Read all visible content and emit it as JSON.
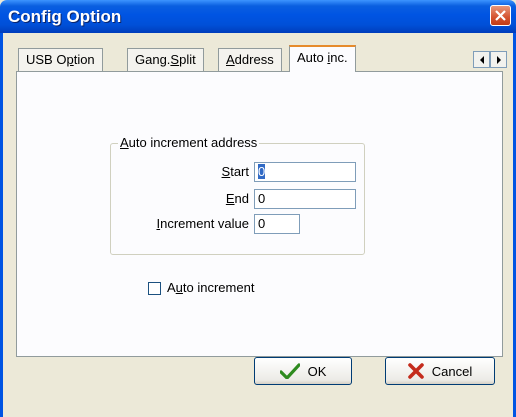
{
  "window": {
    "title": "Config Option"
  },
  "tabs": [
    {
      "label_pre": "USB O",
      "label_key": "p",
      "label_post": "tion"
    },
    {
      "label_pre": "Gang.",
      "label_key": "S",
      "label_post": "plit"
    },
    {
      "label_pre": "",
      "label_key": "A",
      "label_post": "ddress"
    },
    {
      "label_pre": "Auto ",
      "label_key": "i",
      "label_post": "nc.",
      "active": true
    }
  ],
  "group": {
    "legend_key": "A",
    "legend_rest": "uto increment address"
  },
  "fields": {
    "start": {
      "label_key": "S",
      "label_rest": "tart",
      "value": "0"
    },
    "end": {
      "label_key": "E",
      "label_rest": "nd",
      "value": "0"
    },
    "increment": {
      "label_key": "I",
      "label_rest": "ncrement value",
      "value": "0"
    }
  },
  "checkbox": {
    "label_pre": "A",
    "label_key": "u",
    "label_post": "to increment",
    "checked": false
  },
  "buttons": {
    "ok": "OK",
    "cancel": "Cancel"
  },
  "icons": {
    "close": "close-icon",
    "ok": "checkmark-icon",
    "cancel": "cross-icon",
    "left": "arrow-left-icon",
    "right": "arrow-right-icon"
  },
  "colors": {
    "titlebar": "#0054e3",
    "face": "#ece9d8",
    "tab_highlight": "#e68b2c",
    "ok_check": "#2e8b1f",
    "cancel_x": "#c42b1c"
  }
}
